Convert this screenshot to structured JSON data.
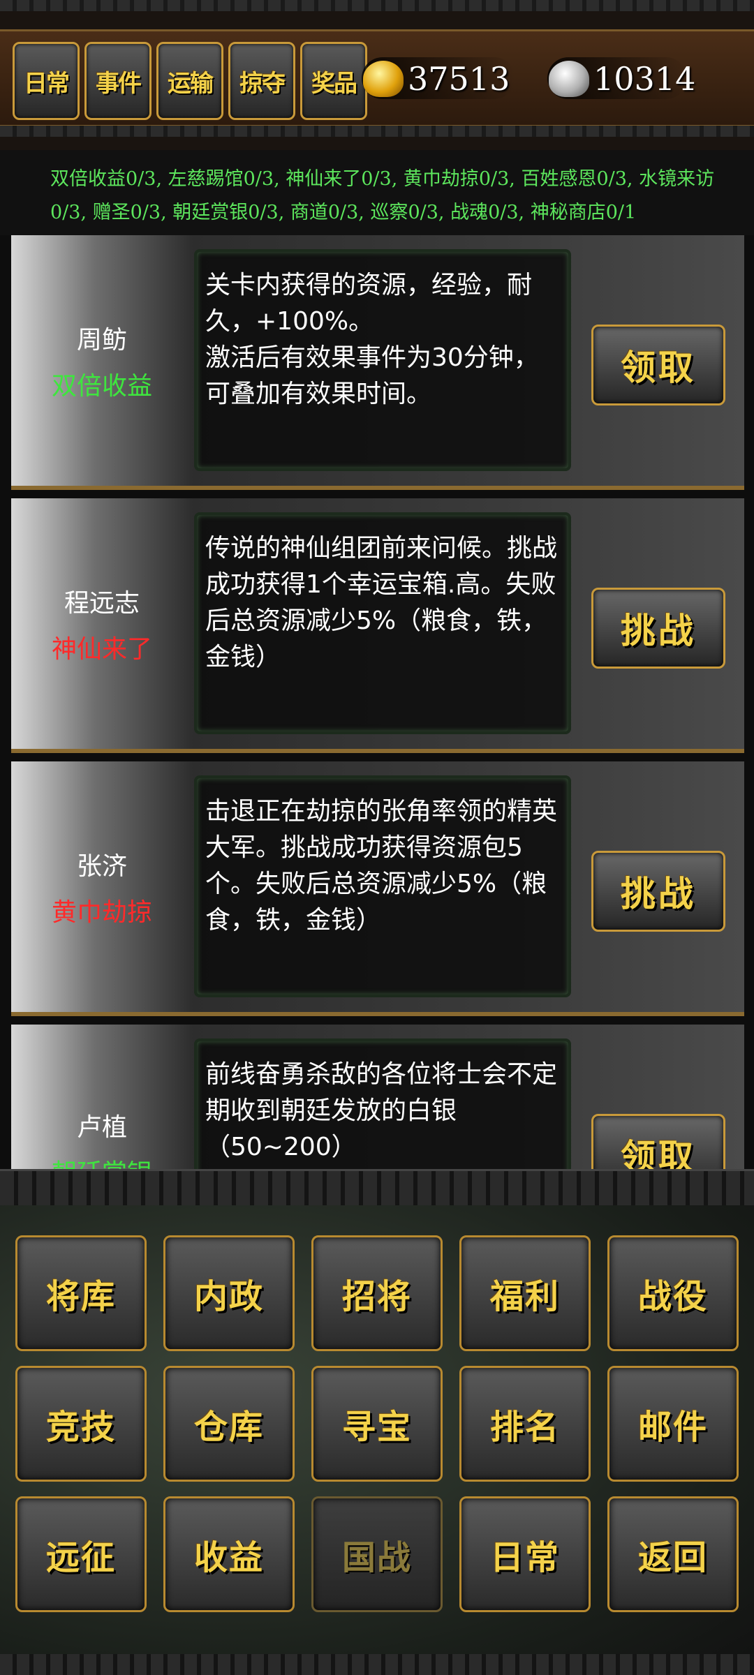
{
  "tabs": [
    {
      "label": "日常"
    },
    {
      "label": "事件"
    },
    {
      "label": "运输"
    },
    {
      "label": "掠夺"
    },
    {
      "label": "奖品"
    }
  ],
  "currency": {
    "gold_icon": "gold-ingot-icon",
    "gold": "37513",
    "silver_icon": "silver-ingot-icon",
    "silver": "10314"
  },
  "event_counts": "双倍收益0/3, 左慈踢馆0/3, 神仙来了0/3, 黄巾劫掠0/3, 百姓感恩0/3, 水镜来访0/3, 赠圣0/3, 朝廷赏银0/3, 商道0/3, 巡察0/3, 战魂0/3, 神秘商店0/1",
  "colors": {
    "event_green": "#3ee63e",
    "event_red": "#ff2a2a",
    "button_text": "#f4d24a",
    "button_border": "#c99a3a"
  },
  "cards": [
    {
      "name": "周鲂",
      "event": "双倍收益",
      "event_color": "#3ee63e",
      "description": "关卡内获得的资源，经验，耐久，+100%。\n激活后有效果事件为30分钟，可叠加有效果时间。",
      "action": "领取"
    },
    {
      "name": "程远志",
      "event": "神仙来了",
      "event_color": "#ff2a2a",
      "description": "传说的神仙组团前来问候。挑战成功获得1个幸运宝箱.高。失败后总资源减少5%（粮食，铁，金钱）",
      "action": "挑战"
    },
    {
      "name": "张济",
      "event": "黄巾劫掠",
      "event_color": "#ff2a2a",
      "description": "击退正在劫掠的张角率领的精英大军。挑战成功获得资源包5个。失败后总资源减少5%（粮食，铁，金钱）",
      "action": "挑战"
    },
    {
      "name": "卢植",
      "event": "朝廷赏银",
      "event_color": "#3ee63e",
      "description": "前线奋勇杀敌的各位将士会不定期收到朝廷发放的白银（50~200）",
      "action": "领取"
    }
  ],
  "menu": [
    {
      "label": "将库"
    },
    {
      "label": "内政"
    },
    {
      "label": "招将"
    },
    {
      "label": "福利"
    },
    {
      "label": "战役"
    },
    {
      "label": "竞技"
    },
    {
      "label": "仓库"
    },
    {
      "label": "寻宝"
    },
    {
      "label": "排名"
    },
    {
      "label": "邮件"
    },
    {
      "label": "远征"
    },
    {
      "label": "收益"
    },
    {
      "label": "国战"
    },
    {
      "label": "日常"
    },
    {
      "label": "返回"
    }
  ]
}
